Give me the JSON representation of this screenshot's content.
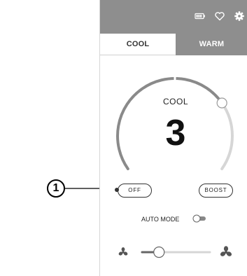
{
  "header": {
    "icons": [
      "battery-icon",
      "heart-icon",
      "gear-icon"
    ]
  },
  "tabs": [
    {
      "label": "COOL",
      "active": true
    },
    {
      "label": "WARM",
      "active": false
    }
  ],
  "gauge": {
    "mode_label": "COOL",
    "level": 3,
    "level_text": "3",
    "fill_fraction": 0.72
  },
  "buttons": {
    "off_label": "OFF",
    "boost_label": "BOOST"
  },
  "auto_mode": {
    "label": "AUTO MODE",
    "enabled": false
  },
  "fan_speed": {
    "fraction": 0.25,
    "low_icon": "fan-low-icon",
    "high_icon": "fan-high-icon"
  },
  "callout": {
    "number": "1"
  },
  "colors": {
    "header_bg": "#8e8e8e",
    "arc_active": "#8a8a8a",
    "arc_inactive": "#d6d6d6"
  }
}
